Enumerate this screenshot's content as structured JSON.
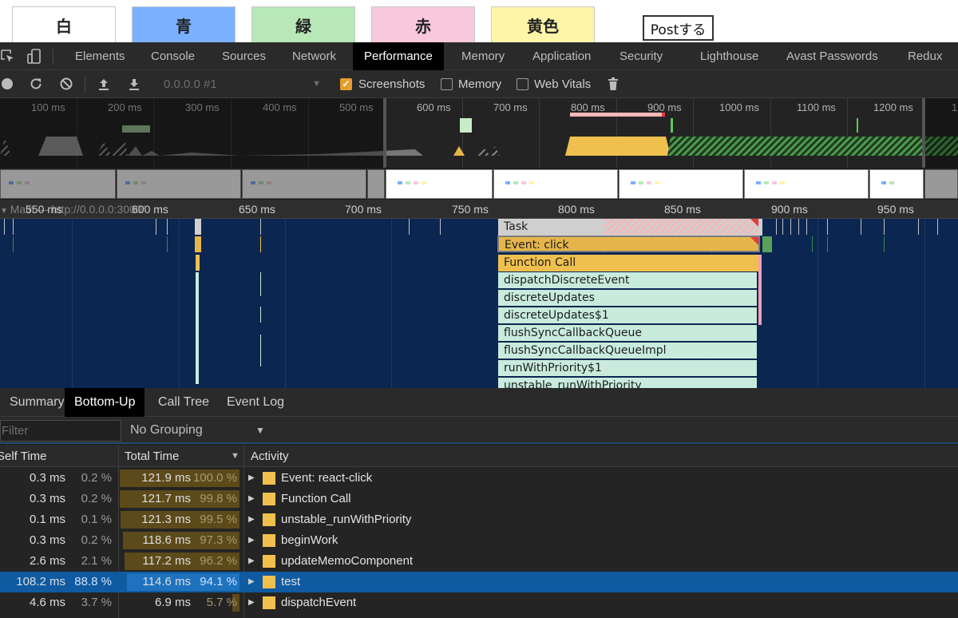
{
  "webpage": {
    "buttons": [
      {
        "label": "白",
        "color": "#ffffff"
      },
      {
        "label": "青",
        "color": "#7ab0ff"
      },
      {
        "label": "緑",
        "color": "#b8e8b8"
      },
      {
        "label": "赤",
        "color": "#f8c8dc"
      },
      {
        "label": "黄色",
        "color": "#fff5a8"
      }
    ],
    "post_label": "Postする"
  },
  "devtools_tabs": [
    "Elements",
    "Console",
    "Sources",
    "Network",
    "Performance",
    "Memory",
    "Application",
    "Security",
    "Lighthouse",
    "Avast Passwords",
    "Redux"
  ],
  "active_tab": "Performance",
  "toolbar": {
    "profile": "0.0.0.0 #1",
    "screenshots_label": "Screenshots",
    "screenshots_checked": true,
    "memory_label": "Memory",
    "memory_checked": false,
    "webvitals_label": "Web Vitals",
    "webvitals_checked": false
  },
  "overview_ticks": [
    "100 ms",
    "200 ms",
    "300 ms",
    "400 ms",
    "500 ms",
    "600 ms",
    "700 ms",
    "800 ms",
    "900 ms",
    "1000 ms",
    "1100 ms",
    "1200 ms",
    "1"
  ],
  "flame_ruler": [
    "550 ms",
    "600 ms",
    "650 ms",
    "700 ms",
    "750 ms",
    "800 ms",
    "850 ms",
    "900 ms",
    "950 ms"
  ],
  "main_track_label": "Main — http://0.0.0.0:3000/",
  "flame_entries": [
    "Task",
    "Event: click",
    "Function Call",
    "dispatchDiscreteEvent",
    "discreteUpdates",
    "discreteUpdates$1",
    "flushSyncCallbackQueue",
    "flushSyncCallbackQueueImpl",
    "runWithPriority$1",
    "unstable_runWithPriority"
  ],
  "subtabs": [
    "Summary",
    "Bottom-Up",
    "Call Tree",
    "Event Log"
  ],
  "active_subtab": "Bottom-Up",
  "filter": {
    "placeholder": "Filter",
    "value": ""
  },
  "grouping": "No Grouping",
  "columns": {
    "self": "Self Time",
    "total": "Total Time",
    "activity": "Activity"
  },
  "rows": [
    {
      "self_ms": "0.3 ms",
      "self_pct": "0.2 %",
      "total_ms": "121.9 ms",
      "total_pct": "100.0 %",
      "activity": "Event: react-click",
      "total_frac": 1.0,
      "selected": false
    },
    {
      "self_ms": "0.3 ms",
      "self_pct": "0.2 %",
      "total_ms": "121.7 ms",
      "total_pct": "99.8 %",
      "activity": "Function Call",
      "total_frac": 0.998,
      "selected": false
    },
    {
      "self_ms": "0.1 ms",
      "self_pct": "0.1 %",
      "total_ms": "121.3 ms",
      "total_pct": "99.5 %",
      "activity": "unstable_runWithPriority",
      "total_frac": 0.995,
      "selected": false
    },
    {
      "self_ms": "0.3 ms",
      "self_pct": "0.2 %",
      "total_ms": "118.6 ms",
      "total_pct": "97.3 %",
      "activity": "beginWork",
      "total_frac": 0.973,
      "selected": false
    },
    {
      "self_ms": "2.6 ms",
      "self_pct": "2.1 %",
      "total_ms": "117.2 ms",
      "total_pct": "96.2 %",
      "activity": "updateMemoComponent",
      "total_frac": 0.962,
      "selected": false
    },
    {
      "self_ms": "108.2 ms",
      "self_pct": "88.8 %",
      "total_ms": "114.6 ms",
      "total_pct": "94.1 %",
      "activity": "test",
      "total_frac": 0.941,
      "selected": true
    },
    {
      "self_ms": "4.6 ms",
      "self_pct": "3.7 %",
      "total_ms": "6.9 ms",
      "total_pct": "5.7 %",
      "activity": "dispatchEvent",
      "total_frac": 0.057,
      "selected": false
    }
  ]
}
